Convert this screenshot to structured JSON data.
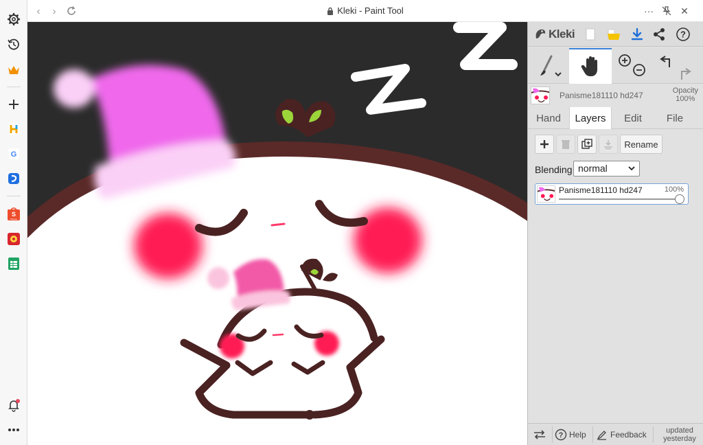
{
  "browser": {
    "title": "Kleki - Paint Tool",
    "nav": {
      "back": "‹",
      "forward": "›"
    },
    "more": "···",
    "close": "✕"
  },
  "sidebar": {
    "items": [
      {
        "name": "settings",
        "icon": "gear-icon"
      },
      {
        "name": "history",
        "icon": "history-icon"
      },
      {
        "name": "crown",
        "icon": "crown-icon"
      },
      {
        "name": "add",
        "icon": "plus-icon"
      },
      {
        "name": "app-h",
        "icon": "h-app-icon"
      },
      {
        "name": "google",
        "icon": "google-icon"
      },
      {
        "name": "app-blue",
        "icon": "blue-app-icon"
      },
      {
        "name": "shopee",
        "icon": "shopee-icon"
      },
      {
        "name": "game",
        "icon": "game-icon"
      },
      {
        "name": "sheets",
        "icon": "sheets-icon"
      },
      {
        "name": "notifications",
        "icon": "bell-icon"
      },
      {
        "name": "more",
        "icon": "more-icon"
      }
    ],
    "labels": {
      "shopee": "Shopee"
    }
  },
  "app": {
    "logo": "Kleki",
    "tools": {
      "active": "hand"
    },
    "layer_info": {
      "name": "Panisme181110 hd247",
      "opacity_label": "Opacity",
      "opacity_value": "100%"
    },
    "tabs": [
      {
        "label": "Hand"
      },
      {
        "label": "Layers"
      },
      {
        "label": "Edit"
      },
      {
        "label": "File"
      }
    ],
    "active_tab": "Layers",
    "layer_buttons": {
      "rename": "Rename"
    },
    "blending": {
      "label": "Blending",
      "value": "normal"
    },
    "layer": {
      "name": "Panisme181110 hd247",
      "opacity": "100%",
      "opacity_fraction": 1.0
    },
    "bottom": {
      "help": "Help",
      "feedback": "Feedback",
      "updated_1": "updated",
      "updated_2": "yesterday"
    }
  },
  "colors": {
    "accent": "#3b83d8",
    "canvas_bg": "#2b2b2b",
    "face_outline": "#5a2a28",
    "hat_pink": "#f069ec",
    "cheek": "#ff1a55",
    "leaf": "#9bd53a"
  }
}
